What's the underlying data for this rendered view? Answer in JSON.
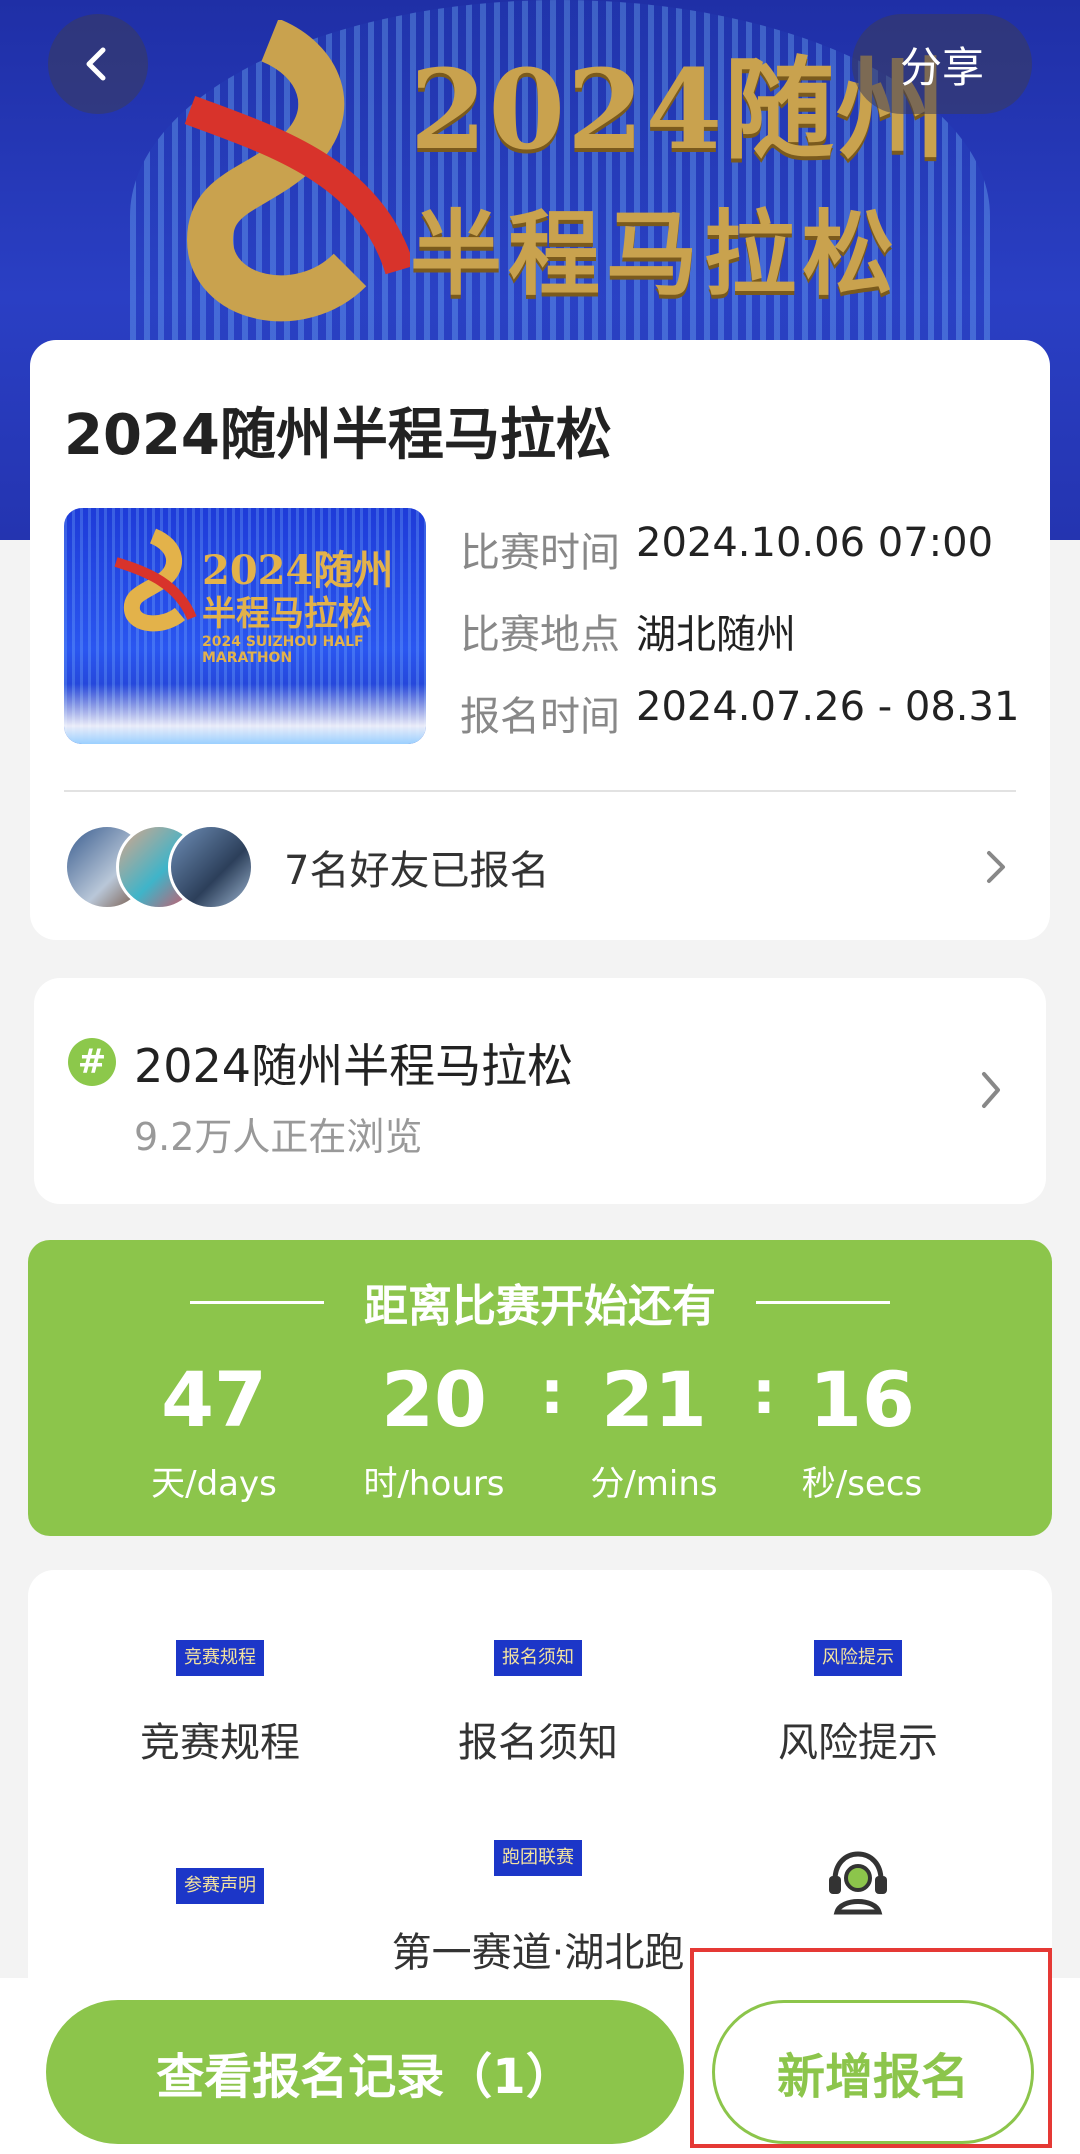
{
  "header": {
    "back_icon": "chevron-left-icon",
    "share_label": "分享",
    "banner_title": "2024随州",
    "banner_subtitle": "半程马拉松"
  },
  "event": {
    "title": "2024随州半程马拉松",
    "poster": {
      "title": "2024随州",
      "subtitle": "半程马拉松",
      "english": "2024 SUIZHOU HALF MARATHON"
    },
    "info": [
      {
        "label": "比赛时间",
        "value": "2024.10.06 07:00"
      },
      {
        "label": "比赛地点",
        "value": "湖北随州"
      },
      {
        "label": "报名时间",
        "value": "2024.07.26 - 08.31"
      }
    ],
    "friends_text": "7名好友已报名"
  },
  "topic": {
    "icon": "hashtag-icon",
    "title": "2024随州半程马拉松",
    "subtitle": "9.2万人正在浏览"
  },
  "countdown": {
    "title": "距离比赛开始还有",
    "units": [
      {
        "value": "47",
        "label": "天/days"
      },
      {
        "value": "20",
        "label": "时/hours"
      },
      {
        "value": "21",
        "label": "分/mins"
      },
      {
        "value": "16",
        "label": "秒/secs"
      }
    ],
    "separator": ":"
  },
  "menu": {
    "items": [
      {
        "thumb": "竞赛规程",
        "label": "竞赛规程"
      },
      {
        "thumb": "报名须知",
        "label": "报名须知"
      },
      {
        "thumb": "风险提示",
        "label": "风险提示"
      },
      {
        "thumb": "参赛声明",
        "label": ""
      },
      {
        "thumb": "跑团联赛",
        "label": "第一赛道·湖北跑"
      },
      {
        "thumb": "headset-icon",
        "label": ""
      }
    ]
  },
  "bottom": {
    "records_label": "查看报名记录（1）",
    "new_label": "新增报名"
  },
  "colors": {
    "accent_green": "#8cc54b",
    "highlight_red": "#e53935",
    "banner_blue": "#2a3fc4"
  }
}
